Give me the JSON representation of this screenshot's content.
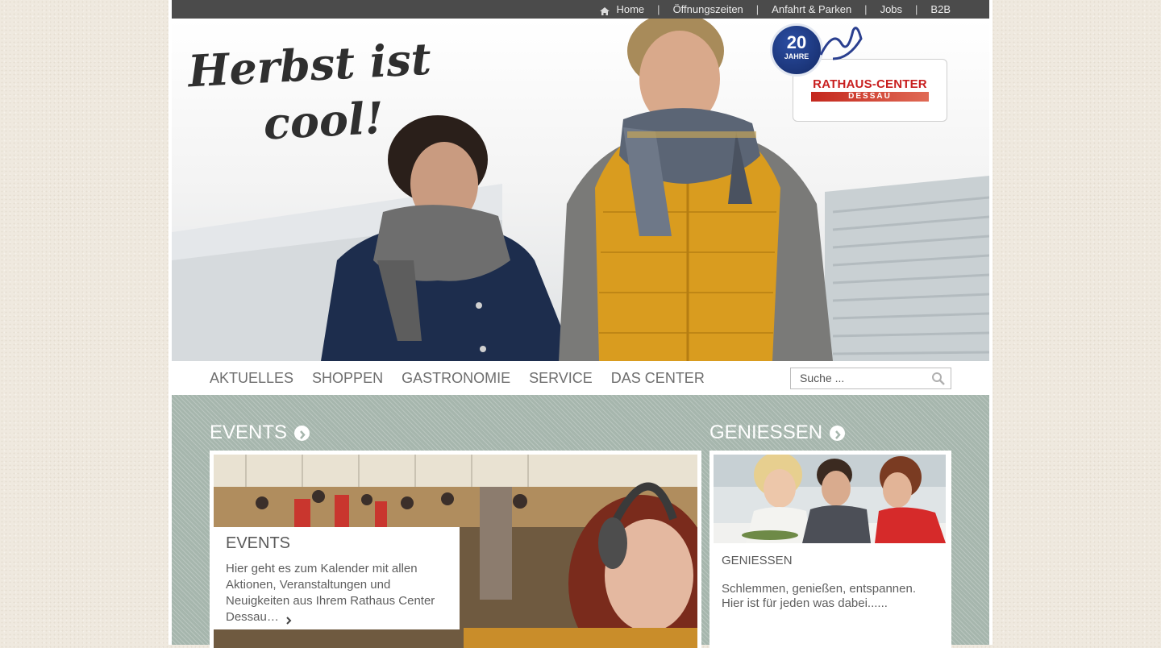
{
  "topnav": {
    "items": [
      {
        "label": "Home",
        "icon": "home-icon"
      },
      {
        "label": "Öffnungszeiten"
      },
      {
        "label": "Anfahrt & Parken"
      },
      {
        "label": "Jobs"
      },
      {
        "label": "B2B"
      }
    ],
    "separator": "|"
  },
  "hero": {
    "tagline_line1": "Herbst ist",
    "tagline_line2": "cool!",
    "badge_number": "20",
    "badge_word": "JAHRE",
    "logo_name": "RATHAUS-CENTER",
    "logo_city": "DESSAU"
  },
  "mainnav": {
    "items": [
      "AKTUELLES",
      "SHOPPEN",
      "GASTRONOMIE",
      "SERVICE",
      "DAS CENTER"
    ],
    "search_placeholder": "Suche ..."
  },
  "events": {
    "heading": "EVENTS",
    "card_title": "EVENTS",
    "card_text": "Hier geht es zum Kalender mit allen Aktionen, Veranstaltungen und Neuigkeiten aus Ihrem Rathaus Center Dessau…"
  },
  "geniessen": {
    "heading": "GENIESSEN",
    "card_title": "GENIESSEN",
    "card_text": "Schlemmen, genießen, entspannen. Hier ist für jeden was dabei......"
  },
  "colors": {
    "topbar": "#4b4b4b",
    "content_bg": "#a6b6ad",
    "logo_red": "#c81e1e",
    "badge_blue": "#1f3b88"
  }
}
